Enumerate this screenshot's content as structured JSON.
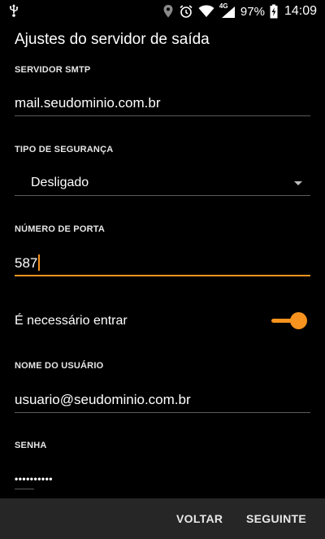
{
  "status_bar": {
    "battery_percent": "97%",
    "network": "4G",
    "time": "14:09"
  },
  "page": {
    "title": "Ajustes do servidor de saída"
  },
  "fields": {
    "smtp_server": {
      "label": "SERVIDOR SMTP",
      "value": "mail.seudominio.com.br"
    },
    "security_type": {
      "label": "TIPO DE SEGURANÇA",
      "value": "Desligado"
    },
    "port_number": {
      "label": "NÚMERO DE PORTA",
      "value": "587"
    },
    "login_required": {
      "label": "É necessário entrar",
      "enabled": true
    },
    "username": {
      "label": "NOME DO USUÁRIO",
      "value": "usuario@seudominio.com.br"
    },
    "password": {
      "label": "SENHA",
      "value": "••••••••••"
    }
  },
  "buttons": {
    "back": "VOLTAR",
    "next": "SEGUINTE"
  },
  "colors": {
    "accent": "#f7931e",
    "background": "#000000",
    "bottom_bar": "#262626"
  }
}
